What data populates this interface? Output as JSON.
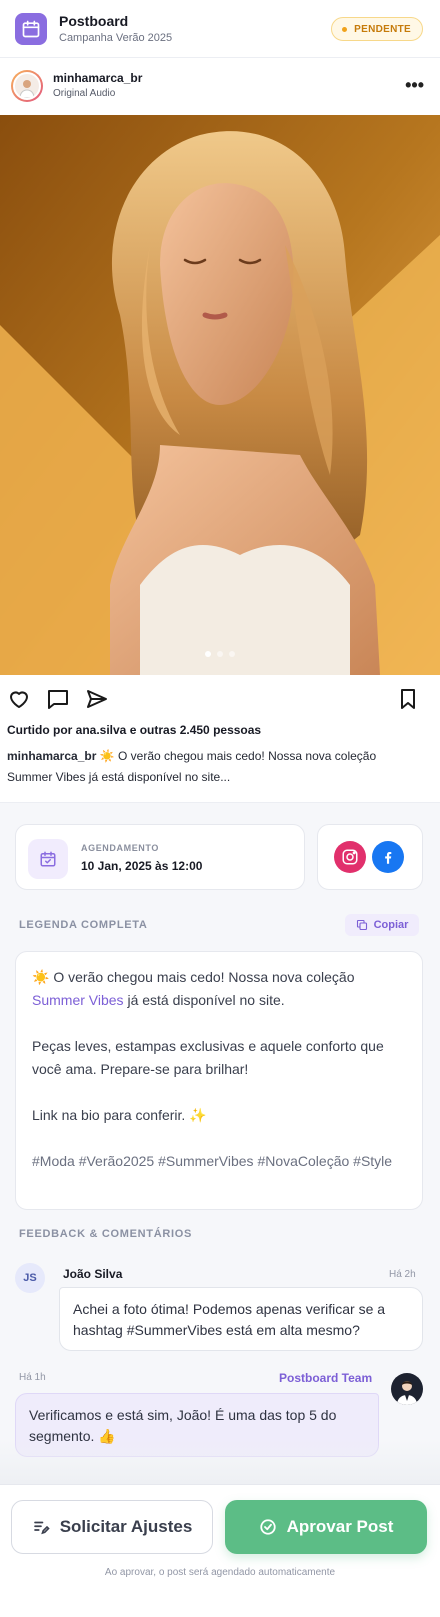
{
  "header": {
    "app_name": "Postboard",
    "campaign": "Campanha Verão 2025",
    "status": "PENDENTE",
    "icon": "calendar-icon"
  },
  "post": {
    "username": "minhamarca_br",
    "audio": "Original Audio",
    "more": "•••",
    "carousel": {
      "count": 3,
      "active": 1
    },
    "likes_text": "Curtido por ana.silva e outras 2.450 pessoas",
    "caption_user": "minhamarca_br",
    "caption_preview": "☀️ O verão chegou mais cedo! Nossa nova coleção Summer Vibes já está disponível no site..."
  },
  "schedule": {
    "label": "AGENDAMENTO",
    "date": "10 Jan, 2025 às 12:00"
  },
  "networks": [
    "instagram-icon",
    "facebook-icon"
  ],
  "legend": {
    "section_title": "LEGENDA COMPLETA",
    "copy_label": "Copiar",
    "line1_a": "☀️ O verão chegou mais cedo! Nossa nova coleção",
    "line1_hl": "Summer Vibes",
    "line1_b": " já está disponível no site.",
    "para2": "Peças leves, estampas exclusivas e aquele conforto que você ama. Prepare-se para brilhar!",
    "para3": "Link na bio para conferir. ✨",
    "hashtags": "#Moda #Verão2025 #SummerVibes #NovaColeção #Style"
  },
  "feedback": {
    "section_title": "FEEDBACK & COMENTÁRIOS",
    "comments": [
      {
        "initials": "JS",
        "author": "João Silva",
        "time": "Há 2h",
        "text": "Achei a foto ótima! Podemos apenas verificar se a hashtag #SummerVibes está em alta mesmo?"
      },
      {
        "author": "Postboard Team",
        "time": "Há 1h",
        "text": "Verificamos e está sim, João! É uma das top 5 do segmento. 👍"
      }
    ]
  },
  "footer": {
    "adjust_label": "Solicitar Ajustes",
    "approve_label": "Aprovar Post",
    "note": "Ao aprovar, o post será agendado automaticamente"
  },
  "colors": {
    "accent": "#8a6de0",
    "approve": "#5cbd86",
    "pending": "#c67b0a",
    "instagram": "#e1306c",
    "facebook": "#1877f2"
  }
}
